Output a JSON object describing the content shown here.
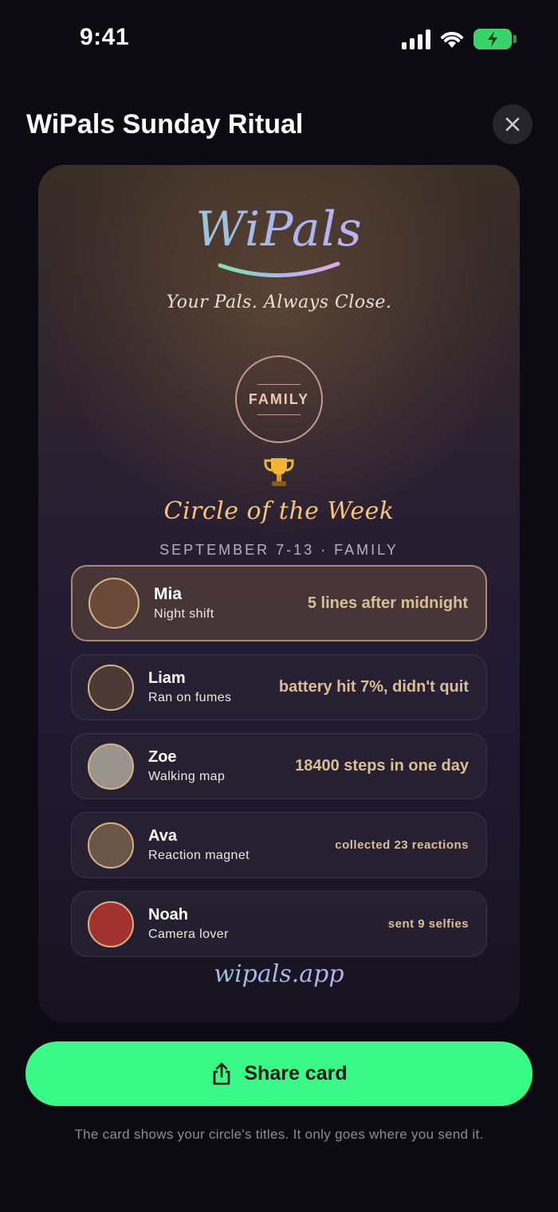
{
  "status_bar": {
    "time": "9:41"
  },
  "header": {
    "title": "WiPals Sunday Ritual"
  },
  "card": {
    "logo": "WiPals",
    "tagline": "Your Pals. Always Close.",
    "badge": "FAMILY",
    "heading": "Circle of the Week",
    "week": "SEPTEMBER 7-13 · FAMILY",
    "members": [
      {
        "name": "Mia",
        "title": "Night shift",
        "stat": "5 lines after midnight",
        "avatar_color": "#6b4a3a"
      },
      {
        "name": "Liam",
        "title": "Ran on fumes",
        "stat": "battery hit 7%, didn't quit",
        "avatar_color": "#4b3a36"
      },
      {
        "name": "Zoe",
        "title": "Walking map",
        "stat": "18400 steps in one day",
        "avatar_color": "#9a948e"
      },
      {
        "name": "Ava",
        "title": "Reaction magnet",
        "stat": "collected 23 reactions",
        "avatar_color": "#6a5548"
      },
      {
        "name": "Noah",
        "title": "Camera lover",
        "stat": "sent 9 selfies",
        "avatar_color": "#a2322e"
      }
    ],
    "site": "wipals.app"
  },
  "share": {
    "label": "Share card"
  },
  "footnote": "The card shows your circle's titles. It only goes where you send it.",
  "colors": {
    "accent": "#39fa86",
    "gold": "#f6c476"
  }
}
